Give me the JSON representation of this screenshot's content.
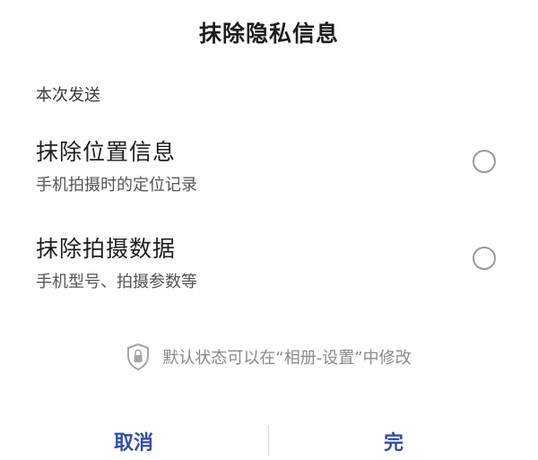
{
  "dialog": {
    "title": "抹除隐私信息",
    "section_label": "本次发送",
    "options": [
      {
        "title": "抹除位置信息",
        "subtitle": "手机拍摄时的定位记录",
        "selected": false
      },
      {
        "title": "抹除拍摄数据",
        "subtitle": "手机型号、拍摄参数等",
        "selected": false
      }
    ],
    "hint": {
      "icon": "shield-lock-icon",
      "text": "默认状态可以在“相册-设置”中修改"
    },
    "buttons": {
      "cancel_label": "取消",
      "done_label": "完"
    }
  },
  "colors": {
    "button_text": "#2f4ea8",
    "radio_border": "#9a9a9a",
    "hint_text": "#8a8a8a"
  }
}
